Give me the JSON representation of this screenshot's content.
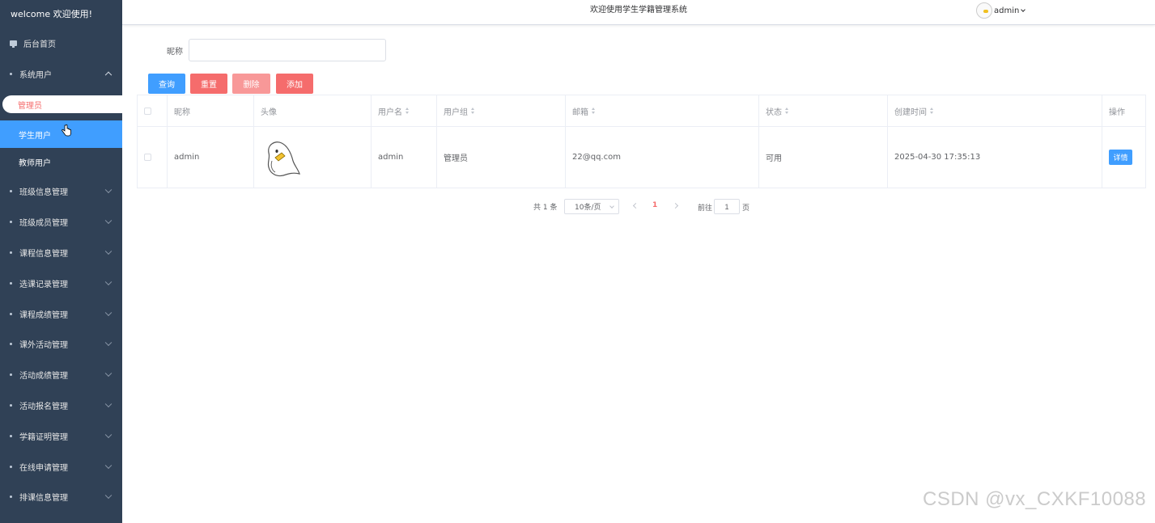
{
  "sidebar": {
    "welcome": "welcome 欢迎使用!",
    "home": "后台首页",
    "system_users": "系统用户",
    "sub_items": [
      "管理员",
      "学生用户",
      "教师用户"
    ],
    "menus": [
      "班级信息管理",
      "班级成员管理",
      "课程信息管理",
      "选课记录管理",
      "课程成绩管理",
      "课外活动管理",
      "活动成绩管理",
      "活动报名管理",
      "学籍证明管理",
      "在线申请管理",
      "排课信息管理"
    ]
  },
  "header": {
    "title": "欢迎使用学生学籍管理系统",
    "user": "admin"
  },
  "search": {
    "label": "昵称",
    "value": ""
  },
  "buttons": {
    "query": "查询",
    "reset": "重置",
    "delete": "删除",
    "add": "添加"
  },
  "table": {
    "columns": [
      "昵称",
      "头像",
      "用户名",
      "用户组",
      "邮箱",
      "状态",
      "创建时间",
      "操作"
    ],
    "rows": [
      {
        "nickname": "admin",
        "username": "admin",
        "group": "管理员",
        "email": "22@qq.com",
        "status": "可用",
        "created": "2025-04-30 17:35:13",
        "action": "详情"
      }
    ]
  },
  "pagination": {
    "total": "共 1 条",
    "page_size": "10条/页",
    "current": "1",
    "goto_label": "前往",
    "goto_value": "1",
    "page_label": "页"
  },
  "watermark": "CSDN @vx_CXKF10088"
}
